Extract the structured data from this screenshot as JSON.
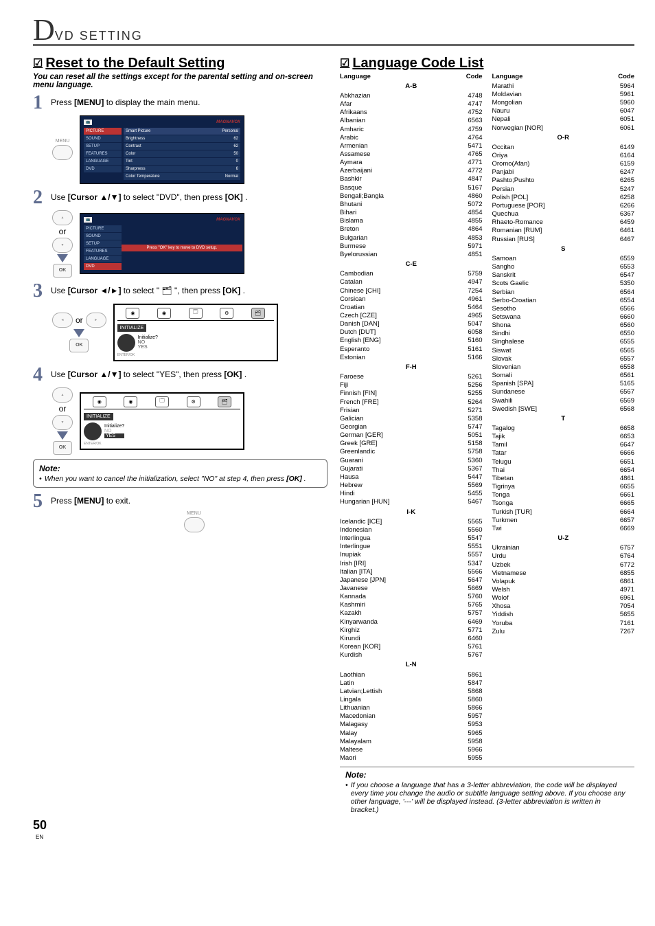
{
  "header": {
    "big_letter": "D",
    "small_text": "VD  SETTING"
  },
  "left": {
    "section_title": "Reset to the Default Setting",
    "intro": "You can reset all the settings except for the parental setting and on-screen menu language.",
    "steps": {
      "s1": {
        "num": "1",
        "text_a": "Press ",
        "btn": "[MENU]",
        "text_b": " to display the main menu."
      },
      "s2": {
        "num": "2",
        "text_a": "Use ",
        "btn": "[Cursor ▲/▼]",
        "text_b": " to select \"DVD\", then press ",
        "btn2": "[OK]",
        "text_c": "."
      },
      "s3": {
        "num": "3",
        "text_a": "Use ",
        "btn": "[Cursor ◄/►]",
        "text_b": " to select \" ",
        "icon": "🗂",
        "text_c": " \", then press ",
        "btn2": "[OK]",
        "text_d": "."
      },
      "s4": {
        "num": "4",
        "text_a": "Use ",
        "btn": "[Cursor ▲/▼]",
        "text_b": " to select \"YES\", then press ",
        "btn2": "[OK]",
        "text_c": "."
      },
      "s5": {
        "num": "5",
        "text_a": "Press ",
        "btn": "[MENU]",
        "text_b": " to exit."
      }
    },
    "menu_label": "MENU",
    "or_label": "or",
    "ok_label": "OK",
    "tv1": {
      "sidebar": [
        "PICTURE",
        "SOUND",
        "SETUP",
        "FEATURES",
        "LANGUAGE",
        "DVD"
      ],
      "rows": [
        [
          "Smart Picture",
          "Personal"
        ],
        [
          "Brightness",
          "62"
        ],
        [
          "Contrast",
          "62"
        ],
        [
          "Color",
          "50"
        ],
        [
          "Tint",
          "0"
        ],
        [
          "Sharpness",
          "6"
        ],
        [
          "Color Temperature",
          "Normal"
        ]
      ]
    },
    "tv2": {
      "sidebar": [
        "PICTURE",
        "SOUND",
        "SETUP",
        "FEATURES",
        "LANGUAGE",
        "DVD"
      ],
      "main_text": "Press \"OK\" key to move to DVD setup."
    },
    "osd": {
      "label": "INITIALIZE",
      "question": "Initialize?",
      "opt_no": "NO",
      "opt_yes": "YES",
      "enter_ok": "ENTER/OK"
    },
    "note": {
      "title": "Note:",
      "text_a": "When you want to cancel the initialization, select \"NO\" at step 4, then press ",
      "btn": "[OK]",
      "text_b": "."
    }
  },
  "right": {
    "section_title": "Language Code List",
    "hdr_lang": "Language",
    "hdr_code": "Code",
    "note": {
      "title": "Note:",
      "text": "If you choose a language that has a 3-letter abbreviation, the code will be displayed every time you change the audio or subtitle language setting above. If you choose any other language, '---' will be displayed instead. (3-letter abbreviation is written in bracket.)"
    },
    "col1": [
      {
        "group": "A-B"
      },
      {
        "lang": "Abkhazian",
        "code": "4748"
      },
      {
        "lang": "Afar",
        "code": "4747"
      },
      {
        "lang": "Afrikaans",
        "code": "4752"
      },
      {
        "lang": "Albanian",
        "code": "6563"
      },
      {
        "lang": "Amharic",
        "code": "4759"
      },
      {
        "lang": "Arabic",
        "code": "4764"
      },
      {
        "lang": "Armenian",
        "code": "5471"
      },
      {
        "lang": "Assamese",
        "code": "4765"
      },
      {
        "lang": "Aymara",
        "code": "4771"
      },
      {
        "lang": "Azerbaijani",
        "code": "4772"
      },
      {
        "lang": "Bashkir",
        "code": "4847"
      },
      {
        "lang": "Basque",
        "code": "5167"
      },
      {
        "lang": "Bengali;Bangla",
        "code": "4860"
      },
      {
        "lang": "Bhutani",
        "code": "5072"
      },
      {
        "lang": "Bihari",
        "code": "4854"
      },
      {
        "lang": "Bislama",
        "code": "4855"
      },
      {
        "lang": "Breton",
        "code": "4864"
      },
      {
        "lang": "Bulgarian",
        "code": "4853"
      },
      {
        "lang": "Burmese",
        "code": "5971"
      },
      {
        "lang": "Byelorussian",
        "code": "4851"
      },
      {
        "group": "C-E"
      },
      {
        "lang": "Cambodian",
        "code": "5759"
      },
      {
        "lang": "Catalan",
        "code": "4947"
      },
      {
        "lang": "Chinese [CHI]",
        "code": "7254"
      },
      {
        "lang": "Corsican",
        "code": "4961"
      },
      {
        "lang": "Croatian",
        "code": "5464"
      },
      {
        "lang": "Czech [CZE]",
        "code": "4965"
      },
      {
        "lang": "Danish [DAN]",
        "code": "5047"
      },
      {
        "lang": "Dutch [DUT]",
        "code": "6058"
      },
      {
        "lang": "English [ENG]",
        "code": "5160"
      },
      {
        "lang": "Esperanto",
        "code": "5161"
      },
      {
        "lang": "Estonian",
        "code": "5166"
      },
      {
        "group": "F-H"
      },
      {
        "lang": "Faroese",
        "code": "5261"
      },
      {
        "lang": "Fiji",
        "code": "5256"
      },
      {
        "lang": "Finnish [FIN]",
        "code": "5255"
      },
      {
        "lang": "French [FRE]",
        "code": "5264"
      },
      {
        "lang": "Frisian",
        "code": "5271"
      },
      {
        "lang": "Galician",
        "code": "5358"
      },
      {
        "lang": "Georgian",
        "code": "5747"
      },
      {
        "lang": "German [GER]",
        "code": "5051"
      },
      {
        "lang": "Greek [GRE]",
        "code": "5158"
      },
      {
        "lang": "Greenlandic",
        "code": "5758"
      },
      {
        "lang": "Guarani",
        "code": "5360"
      },
      {
        "lang": "Gujarati",
        "code": "5367"
      },
      {
        "lang": "Hausa",
        "code": "5447"
      },
      {
        "lang": "Hebrew",
        "code": "5569"
      },
      {
        "lang": "Hindi",
        "code": "5455"
      },
      {
        "lang": "Hungarian [HUN]",
        "code": "5467"
      },
      {
        "group": "I-K"
      },
      {
        "lang": "Icelandic [ICE]",
        "code": "5565"
      },
      {
        "lang": "Indonesian",
        "code": "5560"
      },
      {
        "lang": "Interlingua",
        "code": "5547"
      },
      {
        "lang": "Interlingue",
        "code": "5551"
      },
      {
        "lang": "Inupiak",
        "code": "5557"
      },
      {
        "lang": "Irish [IRI]",
        "code": "5347"
      },
      {
        "lang": "Italian [ITA]",
        "code": "5566"
      },
      {
        "lang": "Japanese [JPN]",
        "code": "5647"
      },
      {
        "lang": "Javanese",
        "code": "5669"
      },
      {
        "lang": "Kannada",
        "code": "5760"
      },
      {
        "lang": "Kashmiri",
        "code": "5765"
      },
      {
        "lang": "Kazakh",
        "code": "5757"
      },
      {
        "lang": "Kinyarwanda",
        "code": "6469"
      },
      {
        "lang": "Kirghiz",
        "code": "5771"
      },
      {
        "lang": "Kirundi",
        "code": "6460"
      },
      {
        "lang": "Korean [KOR]",
        "code": "5761"
      },
      {
        "lang": "Kurdish",
        "code": "5767"
      },
      {
        "group": "L-N"
      },
      {
        "lang": "Laothian",
        "code": "5861"
      },
      {
        "lang": "Latin",
        "code": "5847"
      },
      {
        "lang": "Latvian;Lettish",
        "code": "5868"
      },
      {
        "lang": "Lingala",
        "code": "5860"
      },
      {
        "lang": "Lithuanian",
        "code": "5866"
      },
      {
        "lang": "Macedonian",
        "code": "5957"
      },
      {
        "lang": "Malagasy",
        "code": "5953"
      },
      {
        "lang": "Malay",
        "code": "5965"
      },
      {
        "lang": "Malayalam",
        "code": "5958"
      },
      {
        "lang": "Maltese",
        "code": "5966"
      },
      {
        "lang": "Maori",
        "code": "5955"
      }
    ],
    "col2": [
      {
        "lang": "Marathi",
        "code": "5964"
      },
      {
        "lang": "Moldavian",
        "code": "5961"
      },
      {
        "lang": "Mongolian",
        "code": "5960"
      },
      {
        "lang": "Nauru",
        "code": "6047"
      },
      {
        "lang": "Nepali",
        "code": "6051"
      },
      {
        "lang": "Norwegian [NOR]",
        "code": "6061"
      },
      {
        "group": "O-R"
      },
      {
        "lang": "Occitan",
        "code": "6149"
      },
      {
        "lang": "Oriya",
        "code": "6164"
      },
      {
        "lang": "Oromo(Afan)",
        "code": "6159"
      },
      {
        "lang": "Panjabi",
        "code": "6247"
      },
      {
        "lang": "Pashto;Pushto",
        "code": "6265"
      },
      {
        "lang": "Persian",
        "code": "5247"
      },
      {
        "lang": "Polish [POL]",
        "code": "6258"
      },
      {
        "lang": "Portuguese [POR]",
        "code": "6266"
      },
      {
        "lang": "Quechua",
        "code": "6367"
      },
      {
        "lang": "Rhaeto-Romance",
        "code": "6459"
      },
      {
        "lang": "Romanian [RUM]",
        "code": "6461"
      },
      {
        "lang": "Russian [RUS]",
        "code": "6467"
      },
      {
        "group": "S"
      },
      {
        "lang": "Samoan",
        "code": "6559"
      },
      {
        "lang": "Sangho",
        "code": "6553"
      },
      {
        "lang": "Sanskrit",
        "code": "6547"
      },
      {
        "lang": "Scots Gaelic",
        "code": "5350"
      },
      {
        "lang": "Serbian",
        "code": "6564"
      },
      {
        "lang": "Serbo-Croatian",
        "code": "6554"
      },
      {
        "lang": "Sesotho",
        "code": "6566"
      },
      {
        "lang": "Setswana",
        "code": "6660"
      },
      {
        "lang": "Shona",
        "code": "6560"
      },
      {
        "lang": "Sindhi",
        "code": "6550"
      },
      {
        "lang": "Singhalese",
        "code": "6555"
      },
      {
        "lang": "Siswat",
        "code": "6565"
      },
      {
        "lang": "Slovak",
        "code": "6557"
      },
      {
        "lang": "Slovenian",
        "code": "6558"
      },
      {
        "lang": "Somali",
        "code": "6561"
      },
      {
        "lang": "Spanish [SPA]",
        "code": "5165"
      },
      {
        "lang": "Sundanese",
        "code": "6567"
      },
      {
        "lang": "Swahili",
        "code": "6569"
      },
      {
        "lang": "Swedish [SWE]",
        "code": "6568"
      },
      {
        "group": "T"
      },
      {
        "lang": "Tagalog",
        "code": "6658"
      },
      {
        "lang": "Tajik",
        "code": "6653"
      },
      {
        "lang": "Tamil",
        "code": "6647"
      },
      {
        "lang": "Tatar",
        "code": "6666"
      },
      {
        "lang": "Telugu",
        "code": "6651"
      },
      {
        "lang": "Thai",
        "code": "6654"
      },
      {
        "lang": "Tibetan",
        "code": "4861"
      },
      {
        "lang": "Tigrinya",
        "code": "6655"
      },
      {
        "lang": "Tonga",
        "code": "6661"
      },
      {
        "lang": "Tsonga",
        "code": "6665"
      },
      {
        "lang": "Turkish [TUR]",
        "code": "6664"
      },
      {
        "lang": "Turkmen",
        "code": "6657"
      },
      {
        "lang": "Twi",
        "code": "6669"
      },
      {
        "group": "U-Z"
      },
      {
        "lang": "Ukrainian",
        "code": "6757"
      },
      {
        "lang": "Urdu",
        "code": "6764"
      },
      {
        "lang": "Uzbek",
        "code": "6772"
      },
      {
        "lang": "Vietnamese",
        "code": "6855"
      },
      {
        "lang": "Volapuk",
        "code": "6861"
      },
      {
        "lang": "Welsh",
        "code": "4971"
      },
      {
        "lang": "Wolof",
        "code": "6961"
      },
      {
        "lang": "Xhosa",
        "code": "7054"
      },
      {
        "lang": "Yiddish",
        "code": "5655"
      },
      {
        "lang": "Yoruba",
        "code": "7161"
      },
      {
        "lang": "Zulu",
        "code": "7267"
      }
    ]
  },
  "footer": {
    "page": "50",
    "en": "EN"
  }
}
